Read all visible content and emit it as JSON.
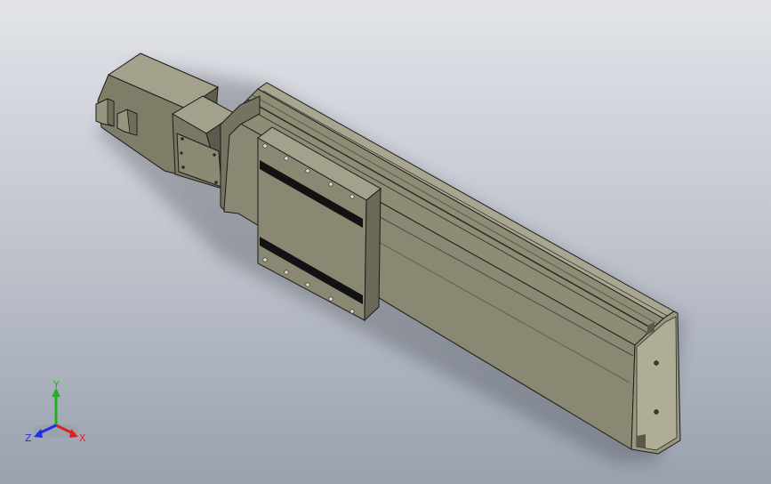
{
  "colors": {
    "background_top": "#e2e4e9",
    "background_bottom": "#9aa2af",
    "part_light": "#97947f",
    "part_mid": "#7f7c68",
    "part_dark": "#4e4c40",
    "edge": "#1c1c1a",
    "slot_black": "#121212",
    "axis_x": "#e02020",
    "axis_y": "#20b020",
    "axis_z": "#2030e0"
  },
  "triad": {
    "x_label": "X",
    "y_label": "Y",
    "z_label": "Z"
  }
}
